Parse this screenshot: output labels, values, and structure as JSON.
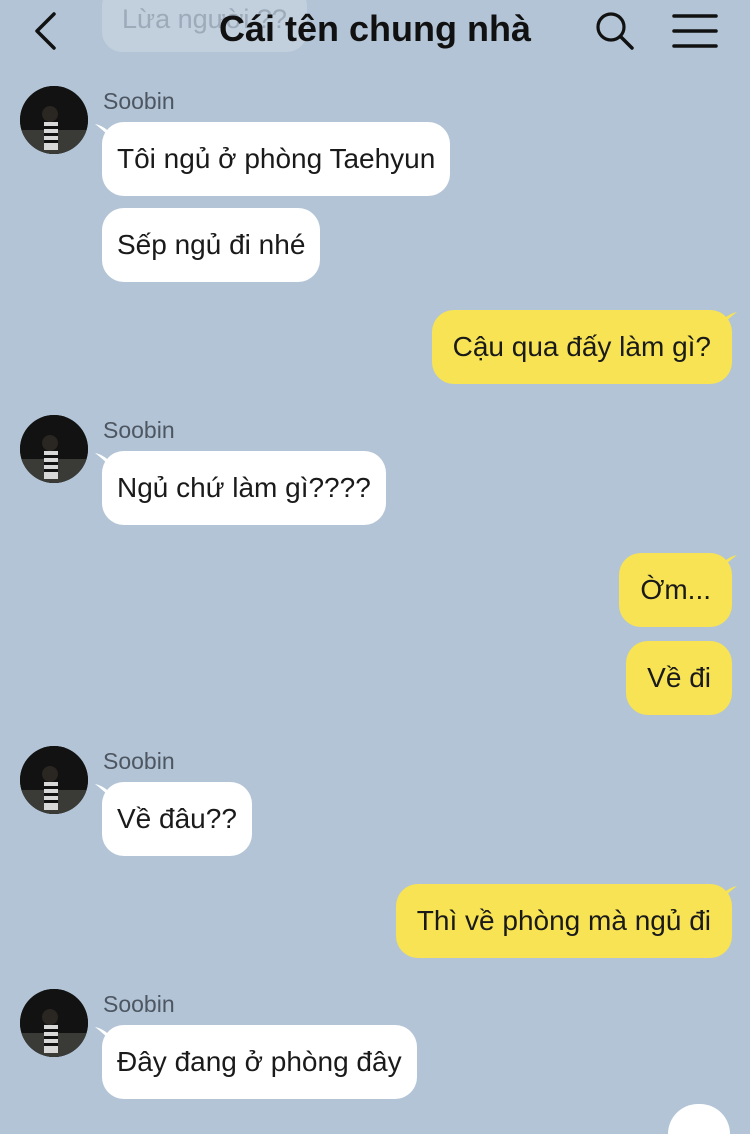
{
  "header": {
    "title": "Cái tên chung nhà",
    "previous_message_faded": "Lừa người ??",
    "back_icon": "chevron-left-icon",
    "search_icon": "search-icon",
    "menu_icon": "hamburger-menu-icon"
  },
  "colors": {
    "background": "#b2c4d6",
    "incoming_bubble": "#ffffff",
    "outgoing_bubble": "#f7e353"
  },
  "messages": [
    {
      "side": "in",
      "sender": "Soobin",
      "text": "Tôi ngủ ở phòng Taehyun"
    },
    {
      "side": "in",
      "text": "Sếp ngủ đi nhé"
    },
    {
      "side": "out",
      "text": "Cậu qua đấy làm gì?"
    },
    {
      "side": "in",
      "sender": "Soobin",
      "text": "Ngủ chứ làm gì????"
    },
    {
      "side": "out",
      "text": "Ờm..."
    },
    {
      "side": "out",
      "text": "Về đi"
    },
    {
      "side": "in",
      "sender": "Soobin",
      "text": "Về đâu??"
    },
    {
      "side": "out",
      "text": "Thì về phòng mà ngủ đi"
    },
    {
      "side": "in",
      "sender": "Soobin",
      "text": "Đây đang ở phòng đây"
    }
  ]
}
